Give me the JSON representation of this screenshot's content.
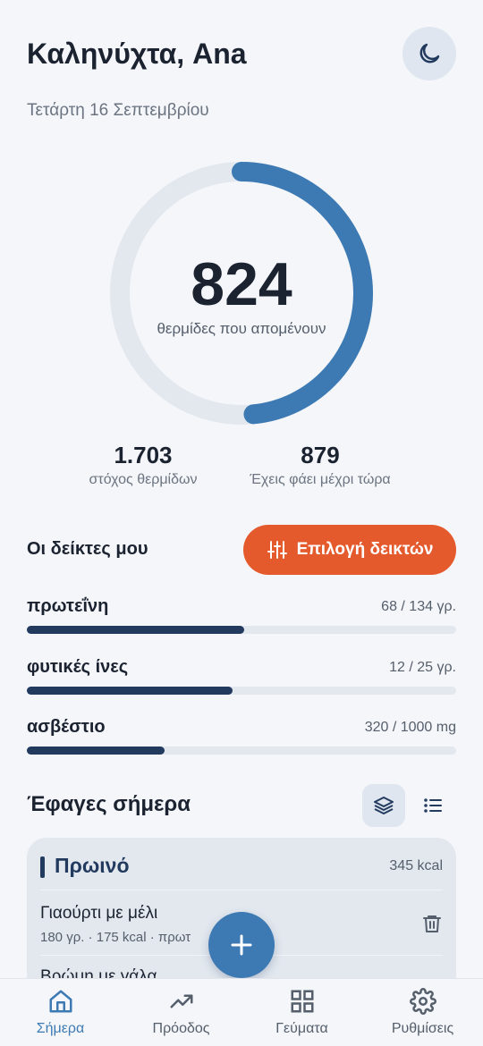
{
  "header": {
    "greeting": "Καληνύχτα, Ana",
    "date": "Τετάρτη 16 Σεπτεμβρίου",
    "theme_icon": "moon-icon"
  },
  "calories": {
    "remaining": "824",
    "remaining_label": "θερμίδες που απομένουν",
    "goal": "1.703",
    "goal_label": "στόχος θερμίδων",
    "eaten": "879",
    "eaten_label": "Έχεις φάει μέχρι τώρα",
    "progress_fraction": 0.484
  },
  "indicators": {
    "title": "Οι δείκτες μου",
    "button_label": "Επιλογή δεικτών",
    "button_icon": "sliders-icon",
    "items": [
      {
        "name": "πρωτεΐνη",
        "amount": "68 / 134 γρ.",
        "fraction": 0.507
      },
      {
        "name": "φυτικές ίνες",
        "amount": "12 / 25 γρ.",
        "fraction": 0.48
      },
      {
        "name": "ασβέστιο",
        "amount": "320 / 1000 mg",
        "fraction": 0.32
      }
    ]
  },
  "eaten_today": {
    "title": "Έφαγες σήμερα",
    "view_icons": [
      "layers-icon",
      "list-icon"
    ],
    "meal": {
      "name": "Πρωινό",
      "kcal": "345 kcal",
      "items": [
        {
          "name": "Γιαούρτι με μέλι",
          "meta": "180 γρ. · 175 kcal · πρωτ"
        },
        {
          "name": "Βρώμη με γάλα",
          "meta": ""
        }
      ]
    }
  },
  "tabs": [
    {
      "label": "Σήμερα",
      "icon": "home-icon",
      "active": true
    },
    {
      "label": "Πρόοδος",
      "icon": "trending-up-icon",
      "active": false
    },
    {
      "label": "Γεύματα",
      "icon": "grid-icon",
      "active": false
    },
    {
      "label": "Ρυθμίσεις",
      "icon": "gear-icon",
      "active": false
    }
  ],
  "colors": {
    "accent": "#3d7ab3",
    "cta": "#e45a2c",
    "dark_bar": "#223a5e",
    "track": "#e3e8ef"
  }
}
